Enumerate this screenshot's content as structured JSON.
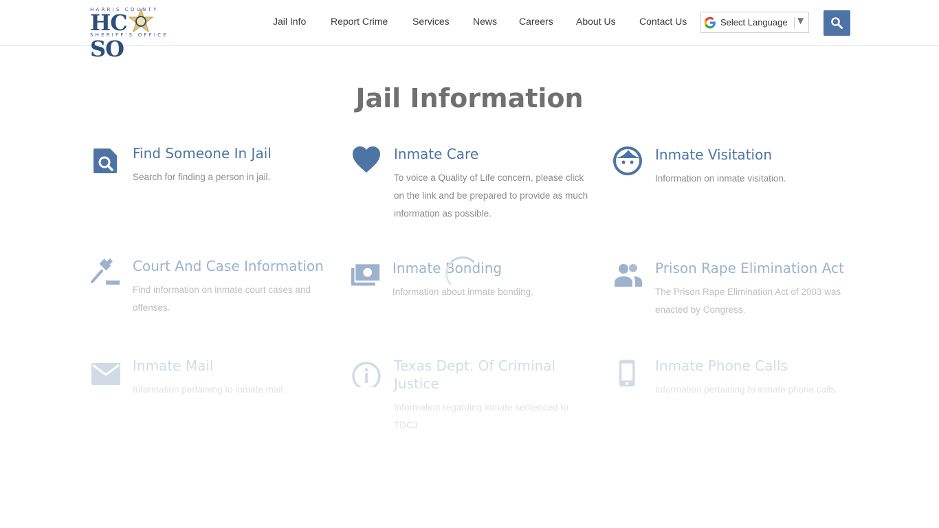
{
  "logo": {
    "top_text": "HARRIS COUNTY",
    "main_left": "HC",
    "main_right": "SO",
    "bottom_text": "SHERIFF'S OFFICE"
  },
  "nav": [
    {
      "label": "Jail Info"
    },
    {
      "label": "Report Crime"
    },
    {
      "label": "Services"
    },
    {
      "label": "News"
    },
    {
      "label": "Careers"
    },
    {
      "label": "About Us"
    },
    {
      "label": "Contact Us"
    }
  ],
  "language": {
    "label": "Select Language"
  },
  "page_title": "Jail Information",
  "cards": [
    {
      "title": "Find Someone In Jail",
      "desc": "Search for finding a person in jail.",
      "icon": "search-document-icon"
    },
    {
      "title": "Inmate Care",
      "desc": "To voice a Quality of Life concern, please click on the link and be prepared to provide as much information as possible.",
      "icon": "heart-icon"
    },
    {
      "title": "Inmate Visitation",
      "desc": "Information on inmate visitation.",
      "icon": "face-icon"
    },
    {
      "title": "Court And Case Information",
      "desc": "Find information on inmate court cases and offenses.",
      "icon": "gavel-icon"
    },
    {
      "title": "Inmate Bonding",
      "desc": "Information about inmate bonding.",
      "icon": "money-icon"
    },
    {
      "title": "Prison Rape Elimination Act",
      "desc": "The Prison Rape Elimination Act of 2003 was enacted by Congress.",
      "icon": "people-icon"
    },
    {
      "title": "Inmate Mail",
      "desc": "Information pertaining to inmate mail.",
      "icon": "mail-icon"
    },
    {
      "title": "Texas Dept. Of Criminal Justice",
      "desc": "Information regarding inmate sentenced to TDCJ.",
      "icon": "info-icon"
    },
    {
      "title": "Inmate Phone Calls",
      "desc": "Information pertaining to inmate phone calls.",
      "icon": "phone-icon"
    }
  ],
  "colors": {
    "accent": "#4d74a5",
    "text": "#707070"
  }
}
